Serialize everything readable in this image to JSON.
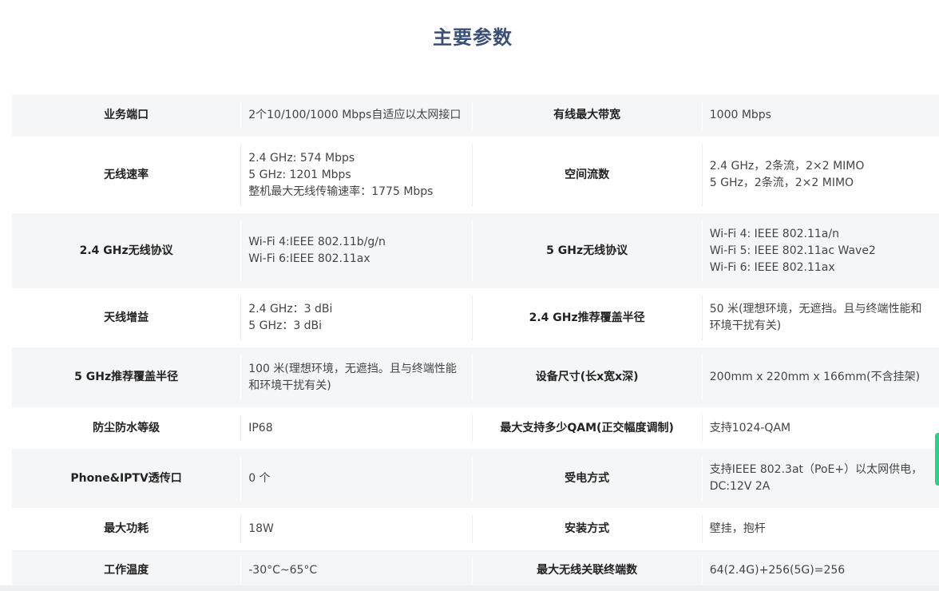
{
  "page": {
    "title": "主要参数"
  },
  "accent_color": "#3a4f78",
  "side_tab_color": "#2ecf8a",
  "rows": [
    {
      "label1": "业务端口",
      "value1": "2个10/100/1000 Mbps自适应以太网接口",
      "label2": "有线最大带宽",
      "value2": "1000 Mbps"
    },
    {
      "label1": "无线速率",
      "value1": "2.4 GHz: 574 Mbps\n5 GHz: 1201 Mbps\n整机最大无线传输速率：1775 Mbps",
      "label2": "空间流数",
      "value2": "2.4 GHz，2条流，2×2 MIMO\n5 GHz，2条流，2×2 MIMO"
    },
    {
      "label1": "2.4 GHz无线协议",
      "value1": "Wi-Fi 4:IEEE 802.11b/g/n\nWi-Fi 6:IEEE 802.11ax",
      "label2": "5 GHz无线协议",
      "value2": "Wi-Fi 4: IEEE 802.11a/n\nWi-Fi 5: IEEE 802.11ac Wave2\nWi-Fi 6: IEEE 802.11ax"
    },
    {
      "label1": "天线增益",
      "value1": "2.4 GHz：3 dBi\n5 GHz：3 dBi",
      "label2": "2.4 GHz推荐覆盖半径",
      "value2": "50 米(理想环境，无遮挡。且与终端性能和环境干扰有关)"
    },
    {
      "label1": "5 GHz推荐覆盖半径",
      "value1": "100 米(理想环境，无遮挡。且与终端性能和环境干扰有关)",
      "label2": "设备尺寸(长x宽x深)",
      "value2": "200mm x 220mm x 166mm(不含挂架)"
    },
    {
      "label1": "防尘防水等级",
      "value1": "IP68",
      "label2": "最大支持多少QAM(正交幅度调制)",
      "value2": "支持1024-QAM"
    },
    {
      "label1": "Phone&IPTV透传口",
      "value1": "0 个",
      "label2": "受电方式",
      "value2": "支持IEEE 802.3at（PoE+）以太网供电，DC:12V 2A"
    },
    {
      "label1": "最大功耗",
      "value1": "18W",
      "label2": "安装方式",
      "value2": "壁挂，抱杆"
    },
    {
      "label1": "工作温度",
      "value1": "-30°C~65°C",
      "label2": "最大无线关联终端数",
      "value2": "64(2.4G)+256(5G)=256"
    }
  ]
}
